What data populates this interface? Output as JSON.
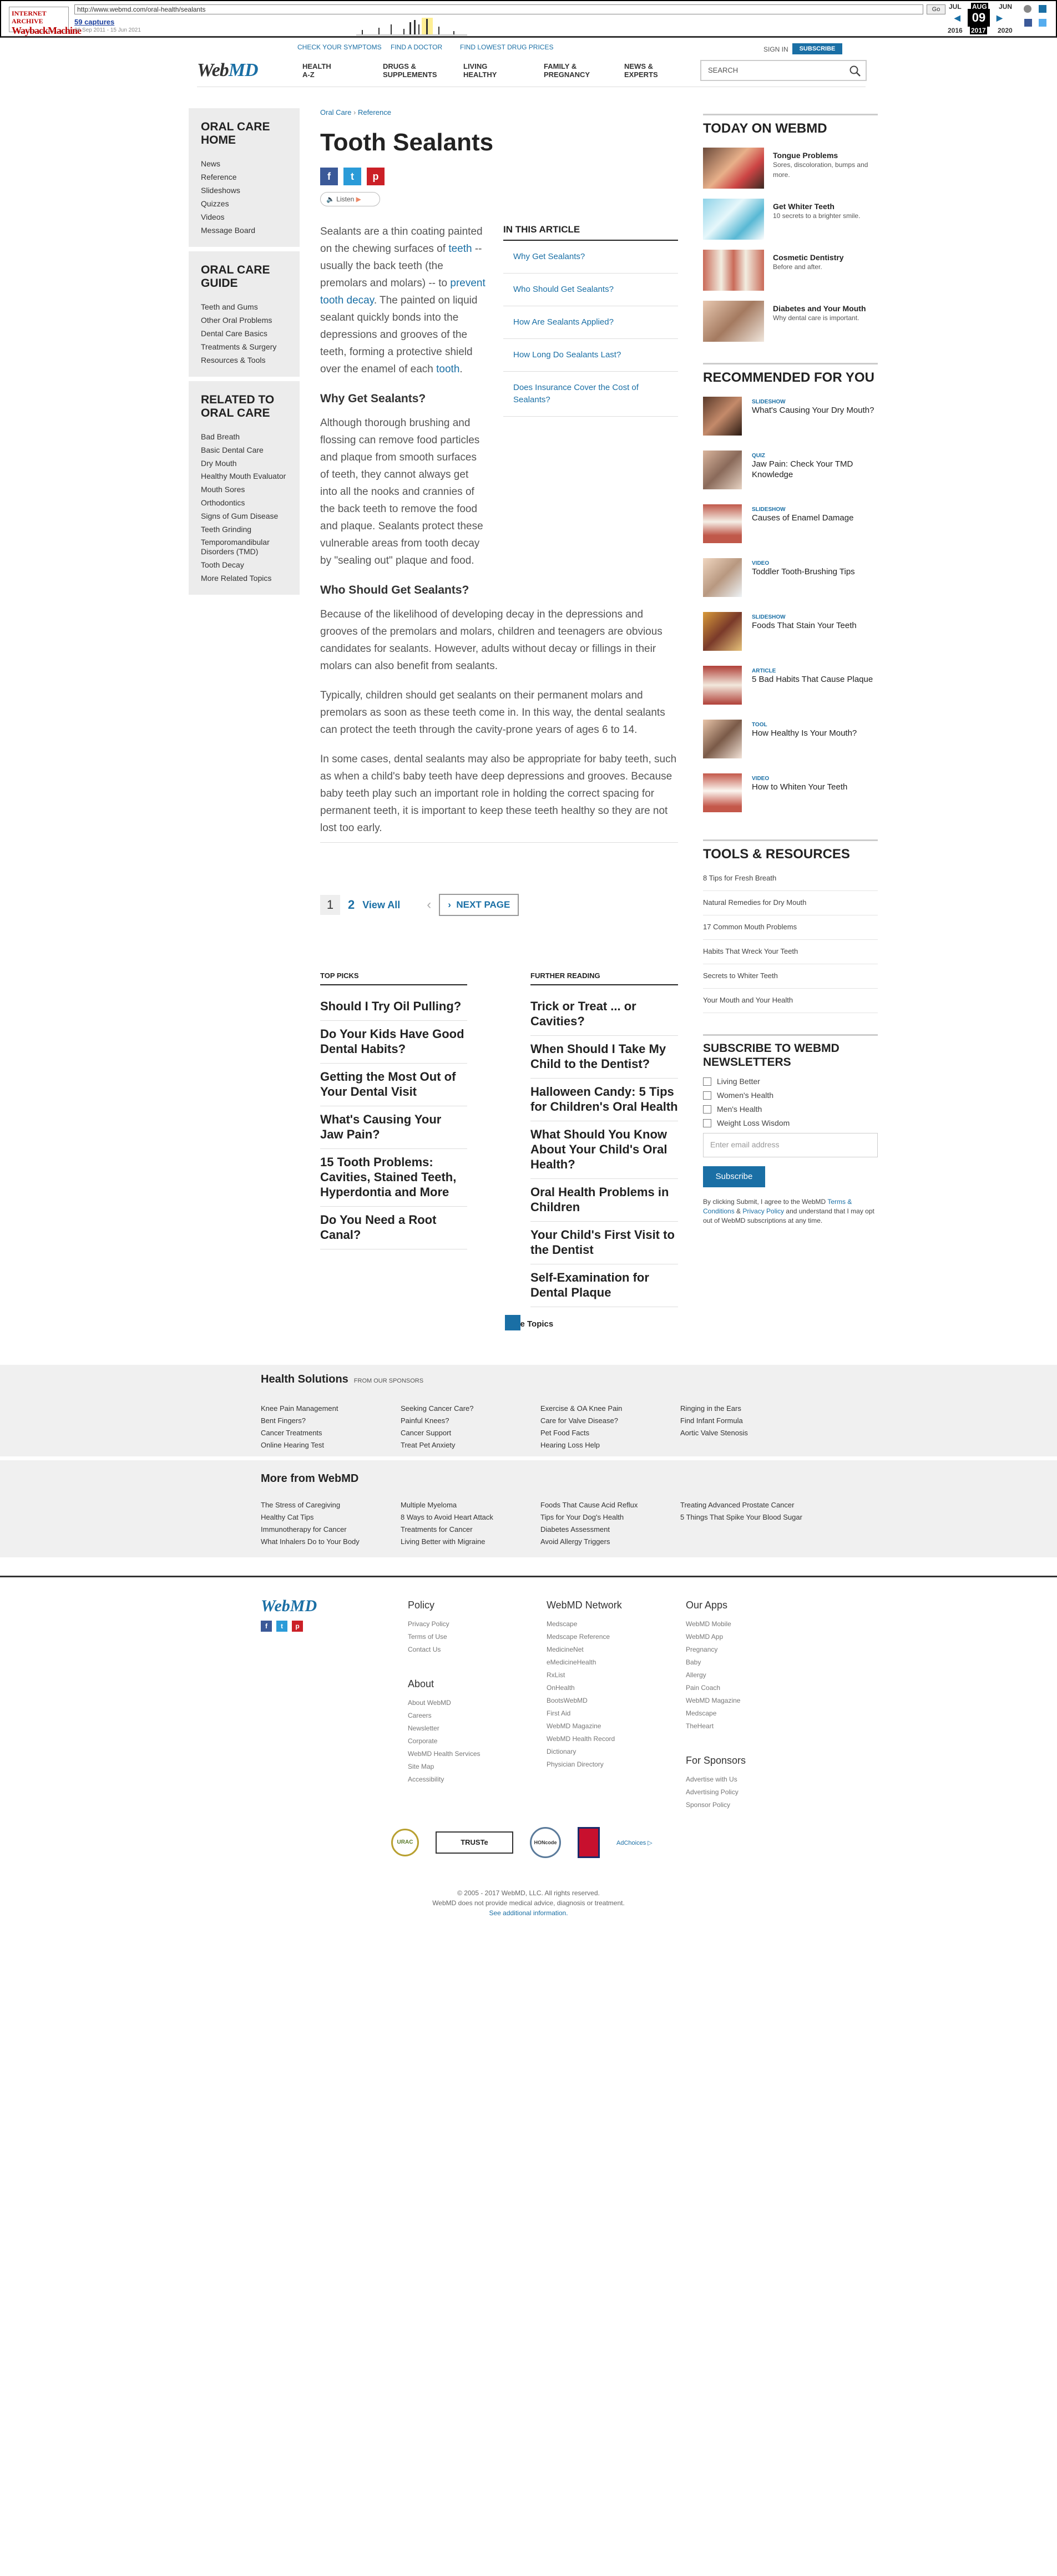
{
  "wayback": {
    "url": "http://www.webmd.com/oral-health/sealants",
    "go": "Go",
    "captures": "59 captures",
    "range": "26 Sep 2011 - 15 Jun 2021",
    "months": [
      "JUL",
      "AUG",
      "JUN"
    ],
    "day": "09",
    "years": [
      "2016",
      "2017",
      "2020"
    ]
  },
  "header": {
    "top_links": [
      "CHECK YOUR SYMPTOMS",
      "FIND A DOCTOR",
      "FIND LOWEST DRUG PRICES"
    ],
    "sign_in": "SIGN IN",
    "subscribe": "SUBSCRIBE",
    "brand_a": "Web",
    "brand_b": "MD",
    "nav": [
      "HEALTH\nA-Z",
      "DRUGS &\nSUPPLEMENTS",
      "LIVING\nHEALTHY",
      "FAMILY &\nPREGNANCY",
      "NEWS &\nEXPERTS"
    ],
    "search_placeholder": "SEARCH"
  },
  "left": {
    "boxes": [
      {
        "title": "ORAL CARE HOME",
        "items": [
          "News",
          "Reference",
          "Slideshows",
          "Quizzes",
          "Videos",
          "Message Board"
        ]
      },
      {
        "title": "ORAL CARE GUIDE",
        "items": [
          "Teeth and Gums",
          "Other Oral Problems",
          "Dental Care Basics",
          "Treatments & Surgery",
          "Resources & Tools"
        ]
      },
      {
        "title": "RELATED TO ORAL CARE",
        "items": [
          "Bad Breath",
          "Basic Dental Care",
          "Dry Mouth",
          "Healthy Mouth Evaluator",
          "Mouth Sores",
          "Orthodontics",
          "Signs of Gum Disease",
          "Teeth Grinding",
          "Temporomandibular Disorders (TMD)",
          "Tooth Decay",
          "More Related Topics"
        ]
      }
    ]
  },
  "article": {
    "crumb": [
      "Oral Care",
      "Reference"
    ],
    "title": "Tooth Sealants",
    "listen": "Listen",
    "intro": [
      "Sealants are a thin coating painted on the chewing surfaces of ",
      "teeth",
      " -- usually the back teeth (the premolars and molars) -- to ",
      "prevent tooth decay",
      ". The painted on liquid sealant quickly bonds into the depressions and grooves of the teeth, forming a protective shield over the enamel of each ",
      "tooth",
      "."
    ],
    "toc_title": "IN THIS ARTICLE",
    "toc": [
      "Why Get Sealants?",
      "Who Should Get Sealants?",
      "How Are Sealants Applied?",
      "How Long Do Sealants Last?",
      "Does Insurance Cover the Cost of Sealants?"
    ],
    "h_why": "Why Get Sealants?",
    "p_why": "Although thorough brushing and flossing can remove food particles and plaque from smooth surfaces of teeth, they cannot always get into all the nooks and crannies of the back teeth to remove the food and plaque. Sealants protect these vulnerable areas from tooth decay by \"sealing out\" plaque and food.",
    "h_who": "Who Should Get Sealants?",
    "p_who1": "Because of the likelihood of developing decay in the depressions and grooves of the premolars and molars, children and teenagers are obvious candidates for sealants. However, adults without decay or fillings in their molars can also benefit from sealants.",
    "p_who2": "Typically, children should get sealants on their permanent molars and premolars as soon as these teeth come in. In this way, the dental sealants can protect the teeth through the cavity-prone years of ages 6 to 14.",
    "p_who3": "In some cases, dental sealants may also be appropriate for baby teeth, such as when a child's baby teeth have deep depressions and grooves. Because baby teeth play such an important role in holding the correct spacing for permanent teeth, it is important to keep these teeth healthy so they are not lost too early.",
    "page1": "1",
    "page2": "2",
    "view_all": "View All",
    "next": "NEXT PAGE"
  },
  "picks": {
    "title": "TOP PICKS",
    "items": [
      "Should I Try Oil Pulling?",
      "Do Your Kids Have Good Dental Habits?",
      "Getting the Most Out of Your Dental Visit",
      "What's Causing Your Jaw Pain?",
      "15 Tooth Problems: Cavities, Stained Teeth, Hyperdontia and More",
      "Do You Need a Root Canal?"
    ]
  },
  "further": {
    "title": "FURTHER READING",
    "items": [
      "Trick or Treat ... or Cavities?",
      "When Should I Take My Child to the Dentist?",
      "Halloween Candy: 5 Tips for Children's Oral Health",
      "What Should You Know About Your Child's Oral Health?",
      "Oral Health Problems in Children",
      "Your Child's First Visit to the Dentist",
      "Self-Examination for Dental Plaque"
    ],
    "more": "More Topics"
  },
  "right": {
    "today_title": "TODAY ON WEBMD",
    "today": [
      {
        "t": "Tongue Problems",
        "d": "Sores, discoloration, bumps and more."
      },
      {
        "t": "Get Whiter Teeth",
        "d": "10 secrets to a brighter smile."
      },
      {
        "t": "Cosmetic Dentistry",
        "d": "Before and after."
      },
      {
        "t": "Diabetes and Your Mouth",
        "d": "Why dental care is important."
      }
    ],
    "rec_title": "RECOMMENDED FOR YOU",
    "rec": [
      {
        "k": "SLIDESHOW",
        "t": "What's Causing Your Dry Mouth?"
      },
      {
        "k": "QUIZ",
        "t": "Jaw Pain: Check Your TMD Knowledge"
      },
      {
        "k": "SLIDESHOW",
        "t": "Causes of Enamel Damage"
      },
      {
        "k": "VIDEO",
        "t": "Toddler Tooth-Brushing Tips"
      },
      {
        "k": "SLIDESHOW",
        "t": "Foods That Stain Your Teeth"
      },
      {
        "k": "ARTICLE",
        "t": "5 Bad Habits That Cause Plaque"
      },
      {
        "k": "TOOL",
        "t": "How Healthy Is Your Mouth?"
      },
      {
        "k": "VIDEO",
        "t": "How to Whiten Your Teeth"
      }
    ],
    "tools_title": "TOOLS & RESOURCES",
    "tools": [
      "8 Tips for Fresh Breath",
      "Natural Remedies for Dry Mouth",
      "17 Common Mouth Problems",
      "Habits That Wreck Your Teeth",
      "Secrets to Whiter Teeth",
      "Your Mouth and Your Health"
    ],
    "nl_title": "SUBSCRIBE TO WEBMD NEWSLETTERS",
    "nl": [
      "Living Better",
      "Women's Health",
      "Men's Health",
      "Weight Loss Wisdom"
    ],
    "email_placeholder": "Enter email address",
    "subscribe": "Subscribe",
    "legal": [
      "By clicking Submit, I agree to the WebMD ",
      "Terms & Conditions",
      " & ",
      "Privacy Policy",
      " and understand that I may opt out of WebMD subscriptions at any time."
    ]
  },
  "solutions": {
    "title": "Health Solutions",
    "sub": "FROM OUR SPONSORS",
    "items": [
      "Knee Pain Management",
      "Seeking Cancer Care?",
      "Exercise & OA Knee Pain",
      "Ringing in the Ears",
      "Bent Fingers?",
      "Painful Knees?",
      "Care for Valve Disease?",
      "Find Infant Formula",
      "Cancer Treatments",
      "Cancer Support",
      "Pet Food Facts",
      "Aortic Valve Stenosis",
      "Online Hearing Test",
      "Treat Pet Anxiety",
      "Hearing Loss Help",
      ""
    ]
  },
  "morefrom": {
    "title": "More from WebMD",
    "items": [
      "The Stress of Caregiving",
      "Multiple Myeloma",
      "Foods That Cause Acid Reflux",
      "Treating Advanced Prostate Cancer",
      "Healthy Cat Tips",
      "8 Ways to Avoid Heart Attack",
      "Tips for Your Dog's Health",
      "5 Things That Spike Your Blood Sugar",
      "Immunotherapy for Cancer",
      "Treatments for Cancer",
      "Diabetes Assessment",
      "",
      "What Inhalers Do to Your Body",
      "Living Better with Migraine",
      "Avoid Allergy Triggers",
      ""
    ]
  },
  "footer": {
    "policy": {
      "t": "Policy",
      "items": [
        "Privacy Policy",
        "Terms of Use",
        "Contact Us"
      ]
    },
    "about": {
      "t": "About",
      "items": [
        "About WebMD",
        "Careers",
        "Newsletter",
        "Corporate",
        "WebMD Health Services",
        "Site Map",
        "Accessibility"
      ]
    },
    "network": {
      "t": "WebMD Network",
      "items": [
        "Medscape",
        "Medscape Reference",
        "MedicineNet",
        "eMedicineHealth",
        "RxList",
        "OnHealth",
        "BootsWebMD",
        "First Aid",
        "WebMD Magazine",
        "WebMD Health Record",
        "Dictionary",
        "Physician Directory"
      ]
    },
    "apps": {
      "t": "Our Apps",
      "items": [
        "WebMD Mobile",
        "WebMD App",
        "Pregnancy",
        "Baby",
        "Allergy",
        "Pain Coach",
        "WebMD Magazine",
        "Medscape",
        "TheHeart"
      ]
    },
    "sponsors": {
      "t": "For Sponsors",
      "items": [
        "Advertise with Us",
        "Advertising Policy",
        "Sponsor Policy"
      ]
    },
    "badges": [
      "URAC",
      "TRUSTe",
      "HONcode",
      "AdChoices"
    ],
    "copy": "© 2005 - 2017 WebMD, LLC. All rights reserved.",
    "disclaimer": "WebMD does not provide medical advice, diagnosis or treatment.",
    "additional": "See additional information."
  }
}
